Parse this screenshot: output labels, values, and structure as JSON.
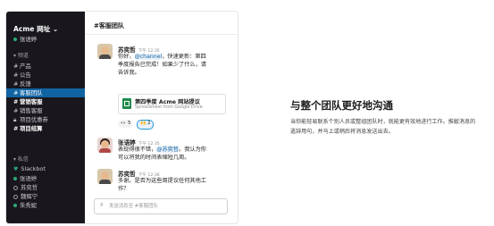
{
  "sidebar": {
    "workspace": "Acme 网址",
    "current_user": "张语婷",
    "channels_header": "频道",
    "channels": [
      {
        "label": "产品",
        "bold": false,
        "active": false
      },
      {
        "label": "公告",
        "bold": false,
        "active": false
      },
      {
        "label": "反馈",
        "bold": false,
        "active": false
      },
      {
        "label": "客服团队",
        "bold": false,
        "active": true
      },
      {
        "label": "营销客服",
        "bold": true,
        "active": false
      },
      {
        "label": "销售客服",
        "bold": false,
        "active": false
      },
      {
        "label": "项目优惠券",
        "bold": false,
        "active": false
      },
      {
        "label": "项目结算",
        "bold": true,
        "active": false
      }
    ],
    "dm_header": "私信",
    "dms": [
      {
        "label": "Slackbot",
        "status": "app"
      },
      {
        "label": "张语婷",
        "status": "online"
      },
      {
        "label": "苏奕哲",
        "status": "away"
      },
      {
        "label": "魏辉宁",
        "status": "away"
      },
      {
        "label": "朱秀妮",
        "status": "online"
      }
    ]
  },
  "channel": {
    "name": "#客服团队",
    "messages": [
      {
        "sender": "苏奕哲",
        "time": "下午 12:35",
        "text_pre": "你好，",
        "mention": "@channel",
        "text_post": "，快速更新：第四季度报告已完成！如果少了什么，请告诉我。"
      },
      {
        "sender": "张语婷",
        "time": "下午 12:35",
        "text_pre": "表现得很不错，",
        "mention": "@苏奕哲",
        "text_post": "。我认为你可以将我的时间表缩短几周。"
      },
      {
        "sender": "苏奕哲",
        "time": "下午 12:36",
        "text_pre": "多谢。是否为这些周提议任何其他工作？",
        "mention": "",
        "text_post": ""
      }
    ],
    "file": {
      "title": "第四季度 Acme 网站提议",
      "subtitle": "Spreadsheet from Google Drive"
    },
    "reactions": [
      {
        "emoji": "👀",
        "count": "5"
      },
      {
        "emoji": "🙌",
        "count": "2"
      }
    ],
    "composer_placeholder": "发送消息至 #客服团队"
  },
  "promo": {
    "headline": "与整个团队更好地沟通",
    "description": "当你能轻易联系个别人员或整组团队时，就能更有效地进行工作。推敲消息的遣辞用句，并马上或稍后将消息发送出去。"
  },
  "colors": {
    "sidebar_bg": "#19171d",
    "active_channel": "#1164a3",
    "online": "#2bac76",
    "mention": "#1264a3"
  }
}
